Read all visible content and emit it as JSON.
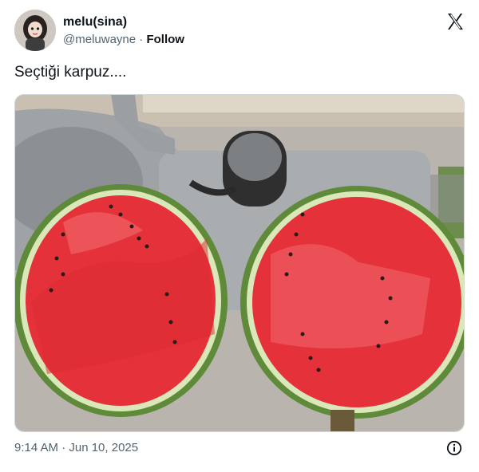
{
  "author": {
    "name": "melu(sina)",
    "handle": "@meluwayne",
    "separator": "·",
    "follow_label": "Follow",
    "avatar_icon": "profile-avatar-icon"
  },
  "tweet": {
    "text": "Seçtiği karpuz....",
    "timestamp": "9:14 AM · Jun 10, 2025"
  },
  "icons": {
    "platform": "x-logo-icon",
    "info": "info-icon"
  },
  "photo": {
    "subject": "two-halves-of-watermelon-in-sink"
  },
  "colors": {
    "text": "#0f1419",
    "secondary": "#536471",
    "watermelon_flesh": "#e5323a",
    "rind": "#5b8a3c"
  }
}
